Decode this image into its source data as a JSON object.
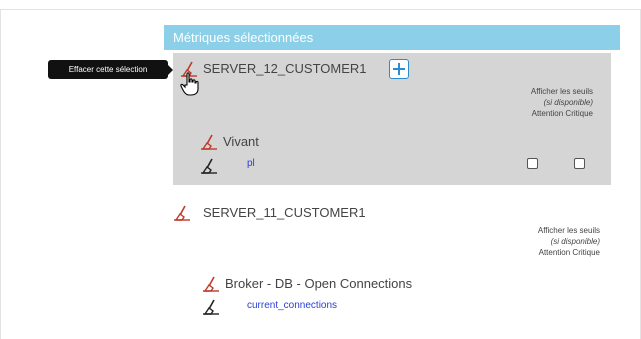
{
  "panel": {
    "title": "Métriques sélectionnées"
  },
  "tooltip": {
    "text": "Effacer cette sélection"
  },
  "servers": [
    {
      "name": "SERVER_12_CUSTOMER1",
      "add_label": "+",
      "thresholds": {
        "line1": "Afficher les seuils",
        "line2": "(si disponible)",
        "warning": "Attention",
        "critical": "Critique"
      },
      "metric": {
        "name": "Vivant",
        "sub": "pl",
        "warning_checked": false,
        "critical_checked": false
      }
    },
    {
      "name": "SERVER_11_CUSTOMER1",
      "thresholds": {
        "line1": "Afficher les seuils",
        "line2": "(si disponible)",
        "warning": "Attention",
        "critical": "Critique"
      },
      "metric": {
        "name": "Broker - DB - Open Connections",
        "sub": "current_connections"
      }
    }
  ],
  "colors": {
    "header": "#8ccfe8",
    "selected_bg": "#d5d5d5",
    "link": "#2a3fd6",
    "broom_red": "#c0392b",
    "add_button": "#2e8bd0"
  },
  "icons": {
    "clear": "broom-icon",
    "add": "plus-icon",
    "cursor": "hand-pointer-icon"
  }
}
